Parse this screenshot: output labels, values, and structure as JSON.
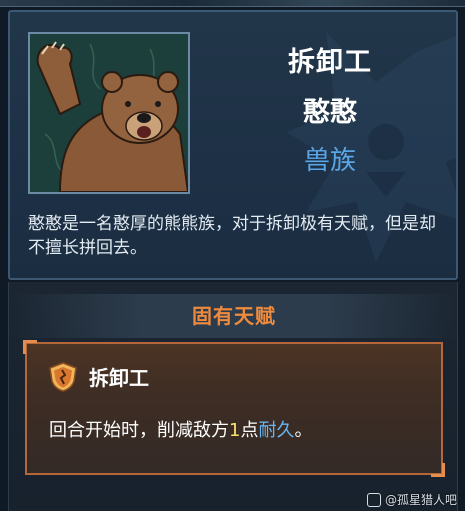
{
  "character": {
    "title": "拆卸工",
    "name": "憨憨",
    "faction": "兽族",
    "description": "憨憨是一名憨厚的熊熊族，对于拆卸极有天赋，但是却不擅长拼回去。",
    "portrait_icon": "bear-portrait-icon"
  },
  "innate_talent": {
    "section_title": "固有天赋",
    "icon": "shield-icon",
    "name": "拆卸工",
    "desc_prefix": "回合开始时，削减敌方",
    "desc_number": "1",
    "desc_middle": "点",
    "desc_keyword": "耐久",
    "desc_suffix": "。"
  },
  "watermark": {
    "text": "@孤星猎人吧"
  },
  "colors": {
    "accent_orange": "#f08a3c",
    "faction_blue": "#5aa6e6",
    "number_yellow": "#f7e36a",
    "keyword_blue": "#6ab6f2"
  }
}
